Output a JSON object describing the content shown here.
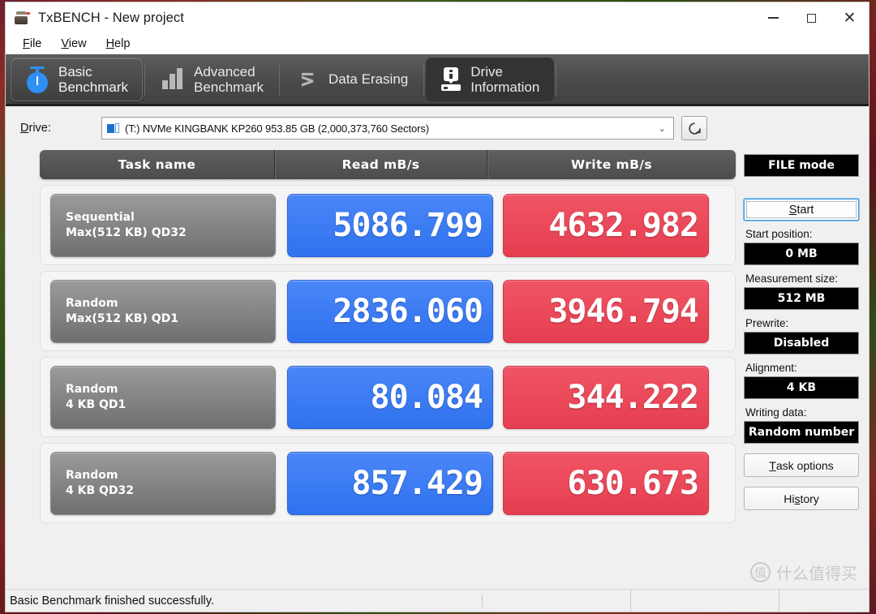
{
  "window": {
    "title": "TxBENCH - New project",
    "icon": "app-icon",
    "minimize": "–",
    "maximize": "□",
    "close": "✕"
  },
  "menu": {
    "items": [
      {
        "accel": "F",
        "rest": "ile"
      },
      {
        "accel": "V",
        "rest": "iew"
      },
      {
        "accel": "H",
        "rest": "elp"
      }
    ]
  },
  "tabs": [
    {
      "label": "Basic\nBenchmark",
      "icon": "stopwatch-icon",
      "active": true
    },
    {
      "label": "Advanced\nBenchmark",
      "icon": "bar-chart-icon",
      "active": false
    },
    {
      "label": "Data Erasing",
      "icon": "zigzag-icon",
      "active": false
    },
    {
      "label": "Drive\nInformation",
      "icon": "drive-info-icon",
      "active": false
    }
  ],
  "drive": {
    "label_accel": "D",
    "label_rest": "rive:",
    "selected": "(T:) NVMe KINGBANK KP260  953.85 GB (2,000,373,760 Sectors)",
    "arrow": "⌄",
    "refresh_icon": "refresh-icon"
  },
  "results": {
    "columns": [
      "Task name",
      "Read mB/s",
      "Write mB/s"
    ],
    "rows": [
      {
        "name_line1": "Sequential",
        "name_line2": "Max(512 KB) QD32",
        "read": "5086.799",
        "write": "4632.982"
      },
      {
        "name_line1": "Random",
        "name_line2": "Max(512 KB) QD1",
        "read": "2836.060",
        "write": "3946.794"
      },
      {
        "name_line1": "Random",
        "name_line2": "4 KB QD1",
        "read": "80.084",
        "write": "344.222"
      },
      {
        "name_line1": "Random",
        "name_line2": "4 KB QD32",
        "read": "857.429",
        "write": "630.673"
      }
    ]
  },
  "sidebar": {
    "file_mode": "FILE mode",
    "start_accel": "S",
    "start_rest": "tart",
    "start_position_label": "Start position:",
    "start_position_value": "0 MB",
    "measurement_size_label": "Measurement size:",
    "measurement_size_value": "512 MB",
    "prewrite_label": "Prewrite:",
    "prewrite_value": "Disabled",
    "alignment_label": "Alignment:",
    "alignment_value": "4 KB",
    "writing_data_label": "Writing data:",
    "writing_data_value": "Random number",
    "task_options_accel": "T",
    "task_options_rest": "ask options",
    "history_pre": "Hi",
    "history_accel": "s",
    "history_rest": "tory"
  },
  "watermark": {
    "badge": "值",
    "text": "什么值得买"
  },
  "statusbar": {
    "message": "Basic Benchmark finished successfully."
  },
  "colors": {
    "read": "#3d7ef5",
    "write": "#ef4c5c",
    "tabstrip": "#4a4a4a",
    "header": "#545454"
  }
}
